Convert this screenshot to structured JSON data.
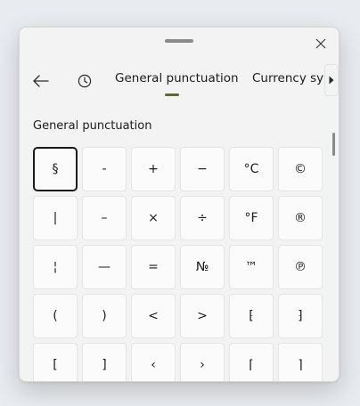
{
  "nav": {
    "tabs": [
      {
        "label": "General punctuation",
        "selected": true
      },
      {
        "label": "Currency symbols",
        "selected": false
      }
    ],
    "visible_partial_tab_label": "Currency sym",
    "accent_color": "#5c6b2a"
  },
  "icons": {
    "close": "close-icon",
    "back": "arrow-left-icon",
    "recent": "clock-icon",
    "scroll_right": "caret-right-icon"
  },
  "section": {
    "heading": "General punctuation"
  },
  "symbols": [
    "§",
    "-",
    "+",
    "−",
    "°C",
    "©",
    "|",
    "–",
    "×",
    "÷",
    "°F",
    "®",
    "¦",
    "—",
    "=",
    "№",
    "™",
    "℗",
    "(",
    ")",
    "<",
    ">",
    "⁅",
    "⁆",
    "[",
    "]",
    "‹",
    "›",
    "⌈",
    "⌉"
  ],
  "selected_symbol_index": 0
}
